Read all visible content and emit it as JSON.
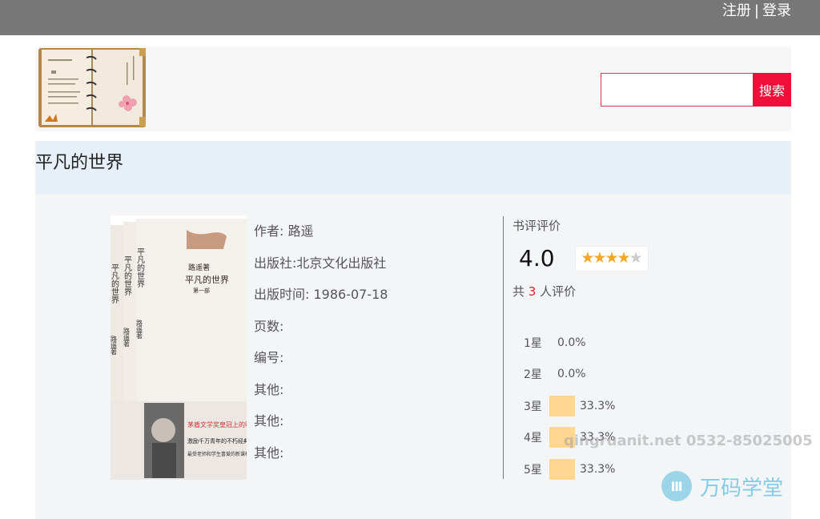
{
  "topbar": {
    "register": "注册",
    "separator": "|",
    "login": "登录"
  },
  "search": {
    "placeholder": "",
    "button": "搜索"
  },
  "book": {
    "title": "平凡的世界",
    "cover_icon": "book-cover-image",
    "info": [
      "作者: 路遥",
      "出版社:北京文化出版社",
      "出版时间: 1986-07-18",
      "页数:",
      "编号:",
      "其他:",
      "其他:",
      "其他:"
    ]
  },
  "rating": {
    "label": "书评评价",
    "score": "4.0",
    "stars": 4,
    "stars_max": 5,
    "count_prefix": "共",
    "count": "3",
    "count_suffix": "人评价",
    "distribution": [
      {
        "label": "1星",
        "value": 0.0,
        "pct": "0.0%"
      },
      {
        "label": "2星",
        "value": 0.0,
        "pct": "0.0%"
      },
      {
        "label": "3星",
        "value": 33.3,
        "pct": "33.3%"
      },
      {
        "label": "4星",
        "value": 33.3,
        "pct": "33.3%"
      },
      {
        "label": "5星",
        "value": 33.3,
        "pct": "33.3%"
      }
    ]
  },
  "watermark": {
    "text": "qingruanit.net 0532-85025005",
    "brand_text": "万码学堂",
    "brand_icon": "brand-logo-icon"
  },
  "colors": {
    "topbar": "#777777",
    "accent": "#ee0f3a",
    "star": "#f5a623",
    "bar": "#ffd790",
    "title_bg": "#e7f0f8"
  }
}
